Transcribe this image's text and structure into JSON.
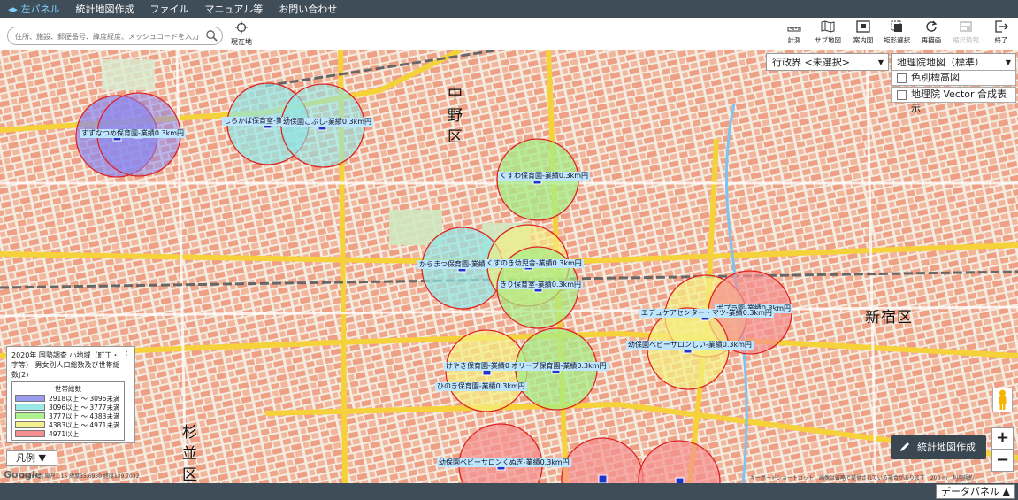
{
  "menu": {
    "left_panel": "◂▸ 左パネル",
    "items": [
      "統計地図作成",
      "ファイル",
      "マニュアル等",
      "お問い合わせ"
    ]
  },
  "toolbar": {
    "search_placeholder": "住所、施設、郵便番号、緯度経度、メッシュコードを入力",
    "locate_label": "現在地",
    "tools": [
      {
        "label": "計測",
        "icon": "ruler-icon"
      },
      {
        "label": "サブ地図",
        "icon": "sub-map-icon"
      },
      {
        "label": "案内図",
        "icon": "guide-map-icon"
      },
      {
        "label": "矩形選択",
        "icon": "rect-select-icon"
      },
      {
        "label": "再描画",
        "icon": "redraw-icon"
      },
      {
        "label": "縮尺情報",
        "icon": "scale-info-icon",
        "disabled": true
      },
      {
        "label": "終了",
        "icon": "exit-icon"
      }
    ]
  },
  "map_controls": {
    "admin_boundary": "行政界 <未選択>",
    "base_map": "地理院地図（標準）",
    "elevation_label": "色別標高図",
    "vector_label": "地理院 Vector 合成表示"
  },
  "wards": {
    "nakano": [
      "中",
      "野",
      "区"
    ],
    "shinjuku": "新宿区",
    "suginami": [
      "杉",
      "並",
      "区"
    ]
  },
  "facilities": [
    {
      "label": "すずなつめ保育園-業績0.3km円"
    },
    {
      "label": "しらかば保育室-業績"
    },
    {
      "label": "幼保園こぶし-業績0.3km円"
    },
    {
      "label": "くすわ保育園-業績0.3km円"
    },
    {
      "label": "からまつ保育園-業績"
    },
    {
      "label": "くすのき幼児舎-業績0.3km円"
    },
    {
      "label": "きり保育室-業績0.3km円"
    },
    {
      "label": "ポプラ園-業績0.3km円"
    },
    {
      "label": "エデュケアセンター・マツ-業績0.3km円"
    },
    {
      "label": "幼保園ベビーサロンしい-業績0.3km円"
    },
    {
      "label": "けやき保育園-業績0.3km円"
    },
    {
      "label": "オリーブ保育園-業績0.3km円"
    },
    {
      "label": "ひのき保育園-業績0.3km円"
    },
    {
      "label": "幼保園ベビーサロンくぬぎ-業績0.3km円"
    }
  ],
  "legend": {
    "title": "2020年 国勢調査 小地域（町丁・字等） 男女別人口総数及び世帯総数(2)",
    "menu_icon": "⋮",
    "subtitle": "世帯総数",
    "rows": [
      {
        "label": "2918以上 ～ 3096未満",
        "color": "#9b9bf0"
      },
      {
        "label": "3096以上 ～ 3777未満",
        "color": "#9be8e8"
      },
      {
        "label": "3777以上 ～ 4383未満",
        "color": "#aef08f"
      },
      {
        "label": "4383以上 ～ 4971未満",
        "color": "#f5f08f"
      },
      {
        "label": "4971以上",
        "color": "#f59090"
      }
    ],
    "button": "凡例 ▼"
  },
  "create_button": "統計地図作成",
  "zoom": {
    "in": "+",
    "out": "−"
  },
  "data_panel": "データパネル ▲",
  "attribution": {
    "left": "200m □ 縮尺1:15  緯度35.6930  経度139.7032",
    "right": "キーボードショートカット　画像は省略で提供されている場合があります　200 m　利用規約",
    "google": "Google"
  }
}
